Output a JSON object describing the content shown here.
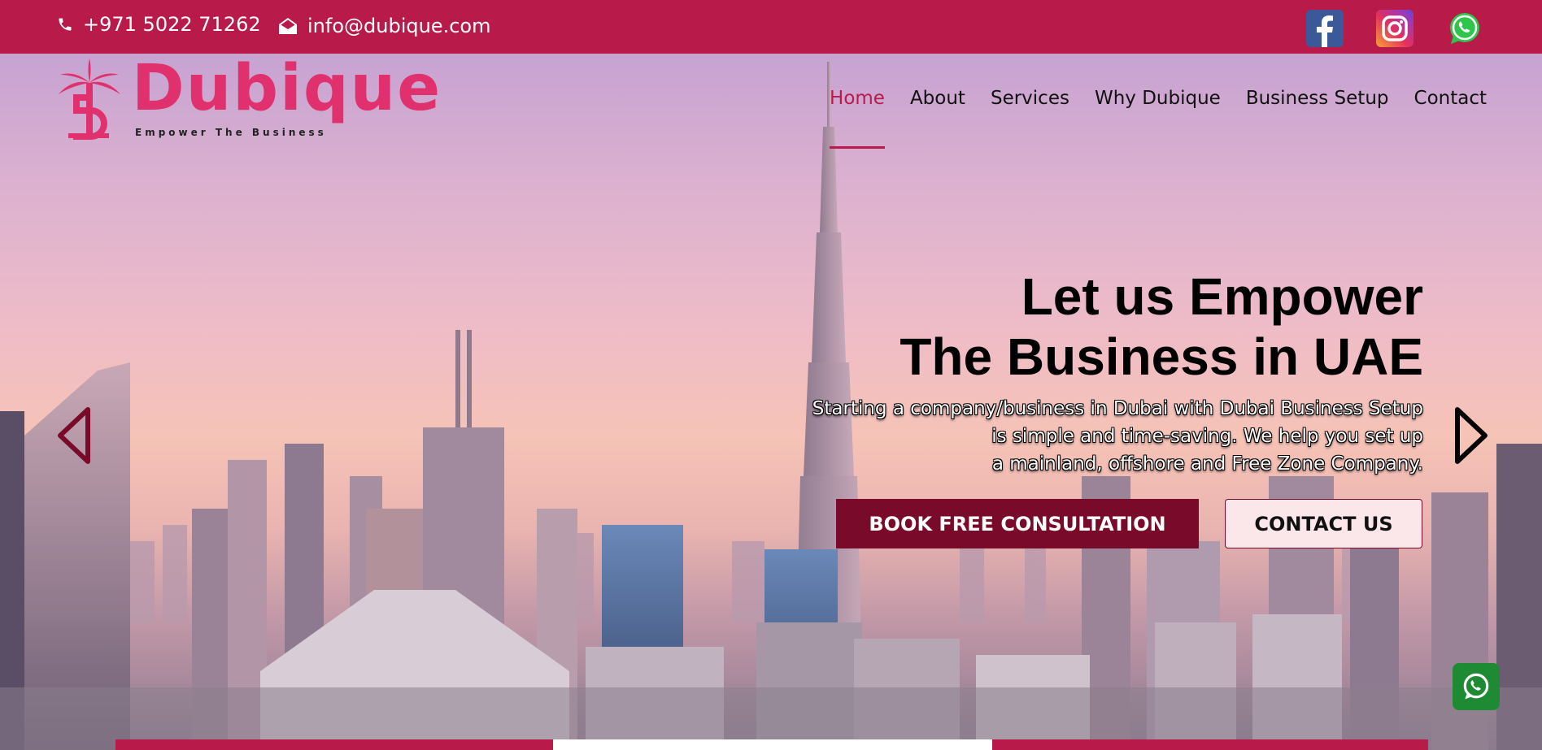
{
  "topbar": {
    "phone": "+971 5022 71262",
    "email": "info@dubique.com",
    "social": [
      "facebook-icon",
      "instagram-icon",
      "whatsapp-icon"
    ]
  },
  "logo": {
    "name": "Dubique",
    "tagline": "Empower  The  Business"
  },
  "nav": {
    "items": [
      {
        "label": "Home",
        "active": true
      },
      {
        "label": "About"
      },
      {
        "label": "Services"
      },
      {
        "label": "Why Dubique"
      },
      {
        "label": "Business Setup"
      },
      {
        "label": "Contact"
      }
    ]
  },
  "hero": {
    "headline_line1": "Let us Empower",
    "headline_line2": "The Business in UAE",
    "sub_line1": "Starting a company/business in Dubai with Dubai Business Setup",
    "sub_line2": "is simple and time-saving. We help you set up",
    "sub_line3": "a mainland, offshore and Free Zone Company.",
    "primary_cta": "BOOK FREE CONSULTATION",
    "secondary_cta": "CONTACT US"
  },
  "colors": {
    "brand": "#b81a4a",
    "brand_dark": "#7a0a2a",
    "logo": "#e0306d"
  }
}
